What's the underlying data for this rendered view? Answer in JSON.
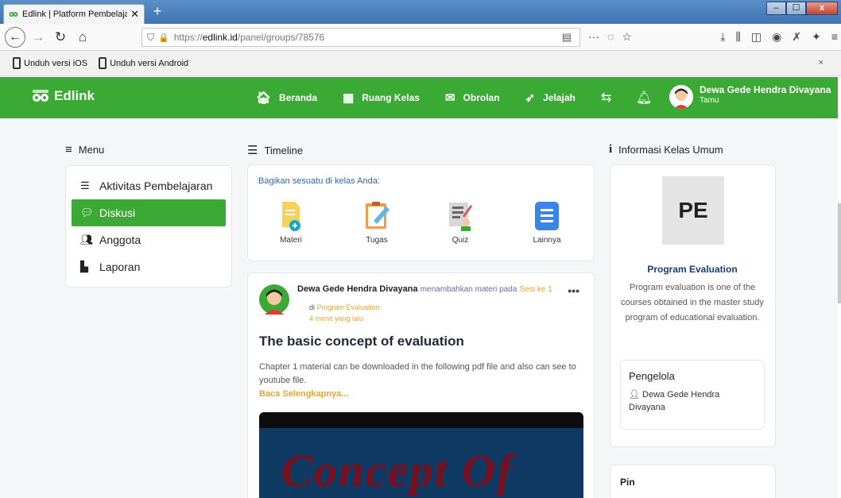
{
  "browser": {
    "tab_title": "Edlink | Platform Pembelajaran",
    "tab_close": "✕",
    "new_tab": "+",
    "url_prefix": "https://",
    "url_domain": "edlink.id",
    "url_path": "/panel/groups/78576",
    "win_min": "–",
    "win_max": "☐",
    "win_close": "x"
  },
  "infobar": {
    "ios_label": "Unduh versi iOS",
    "android_label": "Unduh versi Android",
    "close": "×"
  },
  "app": {
    "brand": "Edlink",
    "nav": [
      {
        "label": "Beranda",
        "icon": "home-icon"
      },
      {
        "label": "Ruang Kelas",
        "icon": "classroom-icon"
      },
      {
        "label": "Obrolan",
        "icon": "chat-icon"
      },
      {
        "label": "Jelajah",
        "icon": "rocket-icon"
      }
    ],
    "user_name": "Dewa Gede Hendra Divayana",
    "user_role": "Tamu",
    "accent": "#3aaa35"
  },
  "menu": {
    "header": "Menu",
    "items": [
      {
        "label": "Aktivitas Pembelajaran",
        "icon": "list-icon"
      },
      {
        "label": "Diskusi",
        "icon": "comments-icon",
        "active": true
      },
      {
        "label": "Anggota",
        "icon": "users-icon"
      },
      {
        "label": "Laporan",
        "icon": "chart-icon"
      }
    ]
  },
  "timeline": {
    "header": "Timeline",
    "share_title": "Bagikan sesuatu di kelas Anda:",
    "share_options": [
      "Materi",
      "Tugas",
      "Quiz",
      "Lainnya"
    ],
    "post": {
      "author": "Dewa Gede Hendra Divayana",
      "verb": "menambahkan materi pada",
      "session": "Sesi ke 1",
      "in_label": "di",
      "course": "Program Evaluation",
      "time": "4 menit yang lalu",
      "dots": "•••",
      "title": "The basic concept of evaluation",
      "body": "Chapter 1 material can be downloaded in the following pdf file and also can see to youtube file.",
      "more": "Baca Selengkapnya...",
      "image_text": "Concept Of"
    }
  },
  "info": {
    "header": "Informasi Kelas Umum",
    "initials": "PE",
    "class_name": "Program Evaluation",
    "description": "Program evaluation is one of the courses obtained in the master study program of educational evaluation.",
    "manager_title": "Pengelola",
    "manager_name": "Dewa Gede Hendra Divayana",
    "pin_title": "Pin"
  }
}
